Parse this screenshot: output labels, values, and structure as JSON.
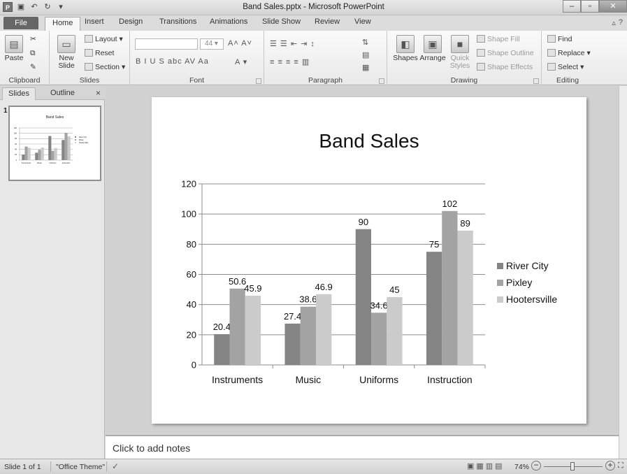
{
  "app": {
    "window_title": "Band Sales.pptx - Microsoft PowerPoint"
  },
  "ribbon_tabs": [
    "File",
    "Home",
    "Insert",
    "Design",
    "Transitions",
    "Animations",
    "Slide Show",
    "Review",
    "View"
  ],
  "ribbon": {
    "clipboard": {
      "paste": "Paste",
      "label": "Clipboard"
    },
    "slides": {
      "new_slide_line1": "New",
      "new_slide_line2": "Slide",
      "layout": "Layout",
      "reset": "Reset",
      "section": "Section",
      "label": "Slides"
    },
    "font": {
      "size": "44",
      "label": "Font",
      "glyphs": "B I U S abc AV Aa"
    },
    "paragraph": {
      "label": "Paragraph"
    },
    "drawing": {
      "shapes": "Shapes",
      "arrange": "Arrange",
      "quick_styles_line1": "Quick",
      "quick_styles_line2": "Styles",
      "shape_fill": "Shape Fill",
      "shape_outline": "Shape Outline",
      "shape_effects": "Shape Effects",
      "label": "Drawing"
    },
    "editing": {
      "find": "Find",
      "replace": "Replace",
      "select": "Select",
      "label": "Editing"
    }
  },
  "left_pane": {
    "tabs": [
      "Slides",
      "Outline"
    ],
    "close": "×",
    "slide_number": "1",
    "thumb_title": "Band Sales"
  },
  "notes": {
    "placeholder": "Click to add notes"
  },
  "status": {
    "slide": "Slide 1 of 1",
    "theme": "\"Office Theme\"",
    "zoom": "74%",
    "zoom_minus": "−",
    "zoom_plus": "+"
  },
  "colors": {
    "river_city": "#848484",
    "pixley": "#a3a3a3",
    "hootersville": "#cbcbcb"
  },
  "chart_data": {
    "type": "bar",
    "title": "Band Sales",
    "categories": [
      "Instruments",
      "Music",
      "Uniforms",
      "Instruction"
    ],
    "series": [
      {
        "name": "River City",
        "values": [
          20.4,
          27.4,
          90,
          75
        ]
      },
      {
        "name": "Pixley",
        "values": [
          50.6,
          38.6,
          34.6,
          102
        ]
      },
      {
        "name": "Hootersville",
        "values": [
          45.9,
          46.9,
          45,
          89
        ]
      }
    ],
    "ylim": [
      0,
      120
    ],
    "yticks": [
      0,
      20,
      40,
      60,
      80,
      100,
      120
    ],
    "grid": true,
    "legend": "right",
    "data_labels": true
  }
}
